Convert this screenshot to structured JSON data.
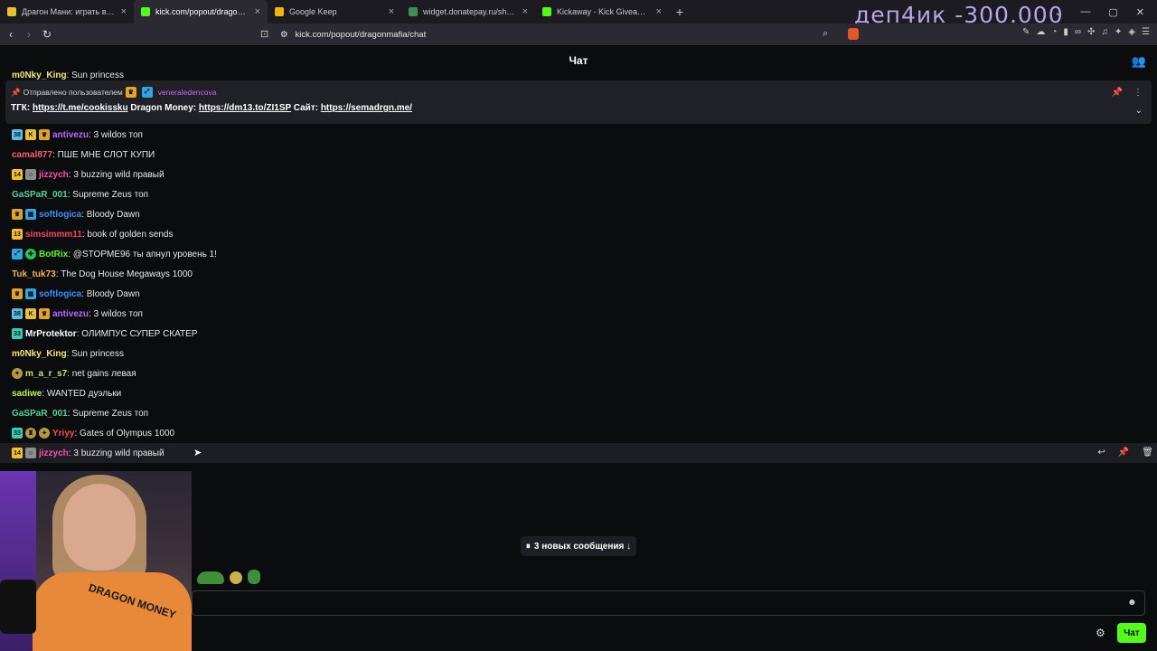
{
  "browser": {
    "tabs": [
      {
        "title": "Драгон Мани: играть в онлайн",
        "favicon_color": "#e8c028",
        "active": false
      },
      {
        "title": "kick.com/popout/dragonmafia/c",
        "favicon_color": "#53fc18",
        "active": true
      },
      {
        "title": "Google Keep",
        "favicon_color": "#f4b400",
        "active": false
      },
      {
        "title": "widget.donatepay.ru/showplaye",
        "favicon_color": "#3a8f5a",
        "active": false
      },
      {
        "title": "Kickaway - Kick Giveaway Tool",
        "favicon_color": "#53fc18",
        "active": false
      }
    ],
    "url": "kick.com/popout/dragonmafia/chat"
  },
  "overlay_text": "деп4ик -300.000",
  "chat": {
    "header_title": "Чат",
    "pinned": {
      "sent_by_label": "Отправлено пользователем",
      "user": "veneraledencova",
      "tgk_label": "ТГК:",
      "tgk_link": "https://t.me/cookissku",
      "dm_label": "Dragon Money:",
      "dm_link": "https://dm13.to/ZI1SP",
      "site_label": "Сайт:",
      "site_link": "https://semadrgn.me/"
    },
    "cut_message": {
      "user": "m0Nky_King",
      "text": "Sun princess"
    },
    "messages": [
      {
        "badges": [
          {
            "cls": "b-sub",
            "label": "38"
          },
          {
            "cls": "b-k",
            "label": "K"
          },
          {
            "cls": "b-crown",
            "label": "♛"
          }
        ],
        "user": "antivezu",
        "color": "#b46cff",
        "text": "3 wildos топ"
      },
      {
        "badges": [],
        "user": "camal877",
        "color": "#ff5c6c",
        "text": "ПШЕ МНЕ СЛОТ КУПИ"
      },
      {
        "badges": [
          {
            "cls": "b-yellow",
            "label": "14"
          },
          {
            "cls": "b-face",
            "label": "☺"
          }
        ],
        "user": "jizzych",
        "color": "#ff4da6",
        "text": "3 buzzing wild правый"
      },
      {
        "badges": [],
        "user": "GaSPaR_001",
        "color": "#4bd4a0",
        "text": "Supreme Zeus топ"
      },
      {
        "badges": [
          {
            "cls": "b-crown",
            "label": "♛"
          },
          {
            "cls": "b-blue",
            "label": "▦"
          }
        ],
        "user": "softlogica",
        "color": "#3b8cff",
        "text": "Bloody Dawn"
      },
      {
        "badges": [
          {
            "cls": "b-yellow",
            "label": "13"
          }
        ],
        "user": "simsimmm11",
        "color": "#ff3b6b",
        "text": "book of golden sends"
      },
      {
        "badges": [
          {
            "cls": "b-blue",
            "label": "⤢"
          },
          {
            "cls": "b-green",
            "label": "✚"
          }
        ],
        "user": "BotRix",
        "color": "#53fc18",
        "text": "@STOPME96 ты апнул уровень 1!"
      },
      {
        "badges": [],
        "user": "Tuk_tuk73",
        "color": "#f2b54a",
        "text": "The Dog House Megaways 1000"
      },
      {
        "badges": [
          {
            "cls": "b-crown",
            "label": "♛"
          },
          {
            "cls": "b-blue",
            "label": "▦"
          }
        ],
        "user": "softlogica",
        "color": "#3b8cff",
        "text": "Bloody Dawn"
      },
      {
        "badges": [
          {
            "cls": "b-sub",
            "label": "38"
          },
          {
            "cls": "b-k",
            "label": "K"
          },
          {
            "cls": "b-crown",
            "label": "♛"
          }
        ],
        "user": "antivezu",
        "color": "#b46cff",
        "text": "3 wildos топ"
      },
      {
        "badges": [
          {
            "cls": "b-teal",
            "label": "33"
          }
        ],
        "user": "MrProtektor",
        "color": "#ffffff",
        "text": "ОЛИМПУС СУПЕР СКАТЕР"
      },
      {
        "badges": [],
        "user": "m0Nky_King",
        "color": "#f1e86a",
        "text": "Sun princess"
      },
      {
        "badges": [
          {
            "cls": "b-emoji",
            "label": "✦"
          }
        ],
        "user": "m_a_r_s7",
        "color": "#c8e66a",
        "text": "net gains левая"
      },
      {
        "badges": [],
        "user": "sadiwe",
        "color": "#b6f24a",
        "text": "WANTED дуэльки"
      },
      {
        "badges": [],
        "user": "GaSPaR_001",
        "color": "#4bd4a0",
        "text": "Supreme Zeus топ"
      },
      {
        "badges": [
          {
            "cls": "b-teal",
            "label": "33"
          },
          {
            "cls": "b-emoji",
            "label": "♜"
          },
          {
            "cls": "b-emoji",
            "label": "✦"
          }
        ],
        "user": "Yriyy",
        "color": "#ff4d4d",
        "text": "Gates of Olympus 1000"
      },
      {
        "badges": [
          {
            "cls": "b-yellow",
            "label": "14"
          },
          {
            "cls": "b-face",
            "label": "☺"
          }
        ],
        "user": "jizzych",
        "color": "#ff4da6",
        "text": "3 buzzing wild правый",
        "highlight": true
      }
    ],
    "new_messages_label": "3 новых сообщения ↓",
    "send_label": "Чат",
    "input_placeholder": ""
  },
  "webcam": {
    "shirt_text": "DRAGON MONEY"
  },
  "icons": {
    "back": "arrow-left-icon",
    "forward": "arrow-right-icon",
    "reload": "reload-icon",
    "bookmark": "bookmark-icon",
    "pin": "pin-icon",
    "settings": "gear-icon"
  }
}
